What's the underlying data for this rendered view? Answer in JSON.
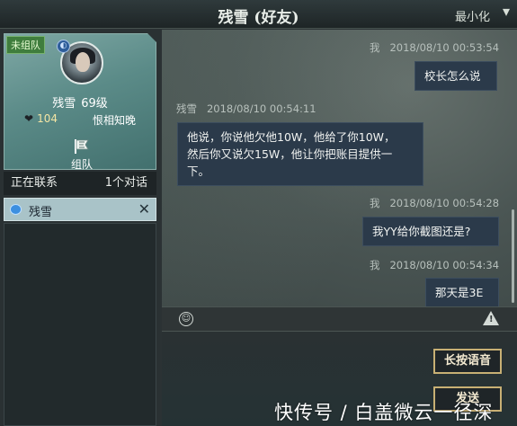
{
  "window": {
    "title": "残雪 (好友)",
    "minimize_label": "最小化"
  },
  "profile": {
    "team_status": "未组队",
    "name": "残雪",
    "level": "69级",
    "intimacy": "104",
    "relation": "恨相知晚",
    "team_button_label": "组队"
  },
  "contacts": {
    "header_label": "正在联系",
    "count_label": "1个对话",
    "items": [
      {
        "name": "残雪"
      }
    ]
  },
  "messages": [
    {
      "sender": "我",
      "time": "2018/08/10  00:53:54",
      "text": "校长怎么说",
      "side": "right"
    },
    {
      "sender": "残雪",
      "time": "2018/08/10  00:54:11",
      "lines": [
        "他说，你说他欠他10W，他给了你10W，",
        "然后你又说欠15W，他让你把账目提供一",
        "下。"
      ],
      "side": "left"
    },
    {
      "sender": "我",
      "time": "2018/08/10  00:54:28",
      "text": "我YY给你截图还是?",
      "side": "right"
    },
    {
      "sender": "我",
      "time": "2018/08/10  00:54:34",
      "text": "那天是3E",
      "side": "right"
    }
  ],
  "actions": {
    "voice_label": "长按语音",
    "send_label": "发送"
  },
  "watermark": "快传号 / 白盖微云一径深",
  "colors": {
    "bubble": "#2b3a4a",
    "button_border": "#c8b074",
    "contact_selected": "#a9c3c8"
  }
}
